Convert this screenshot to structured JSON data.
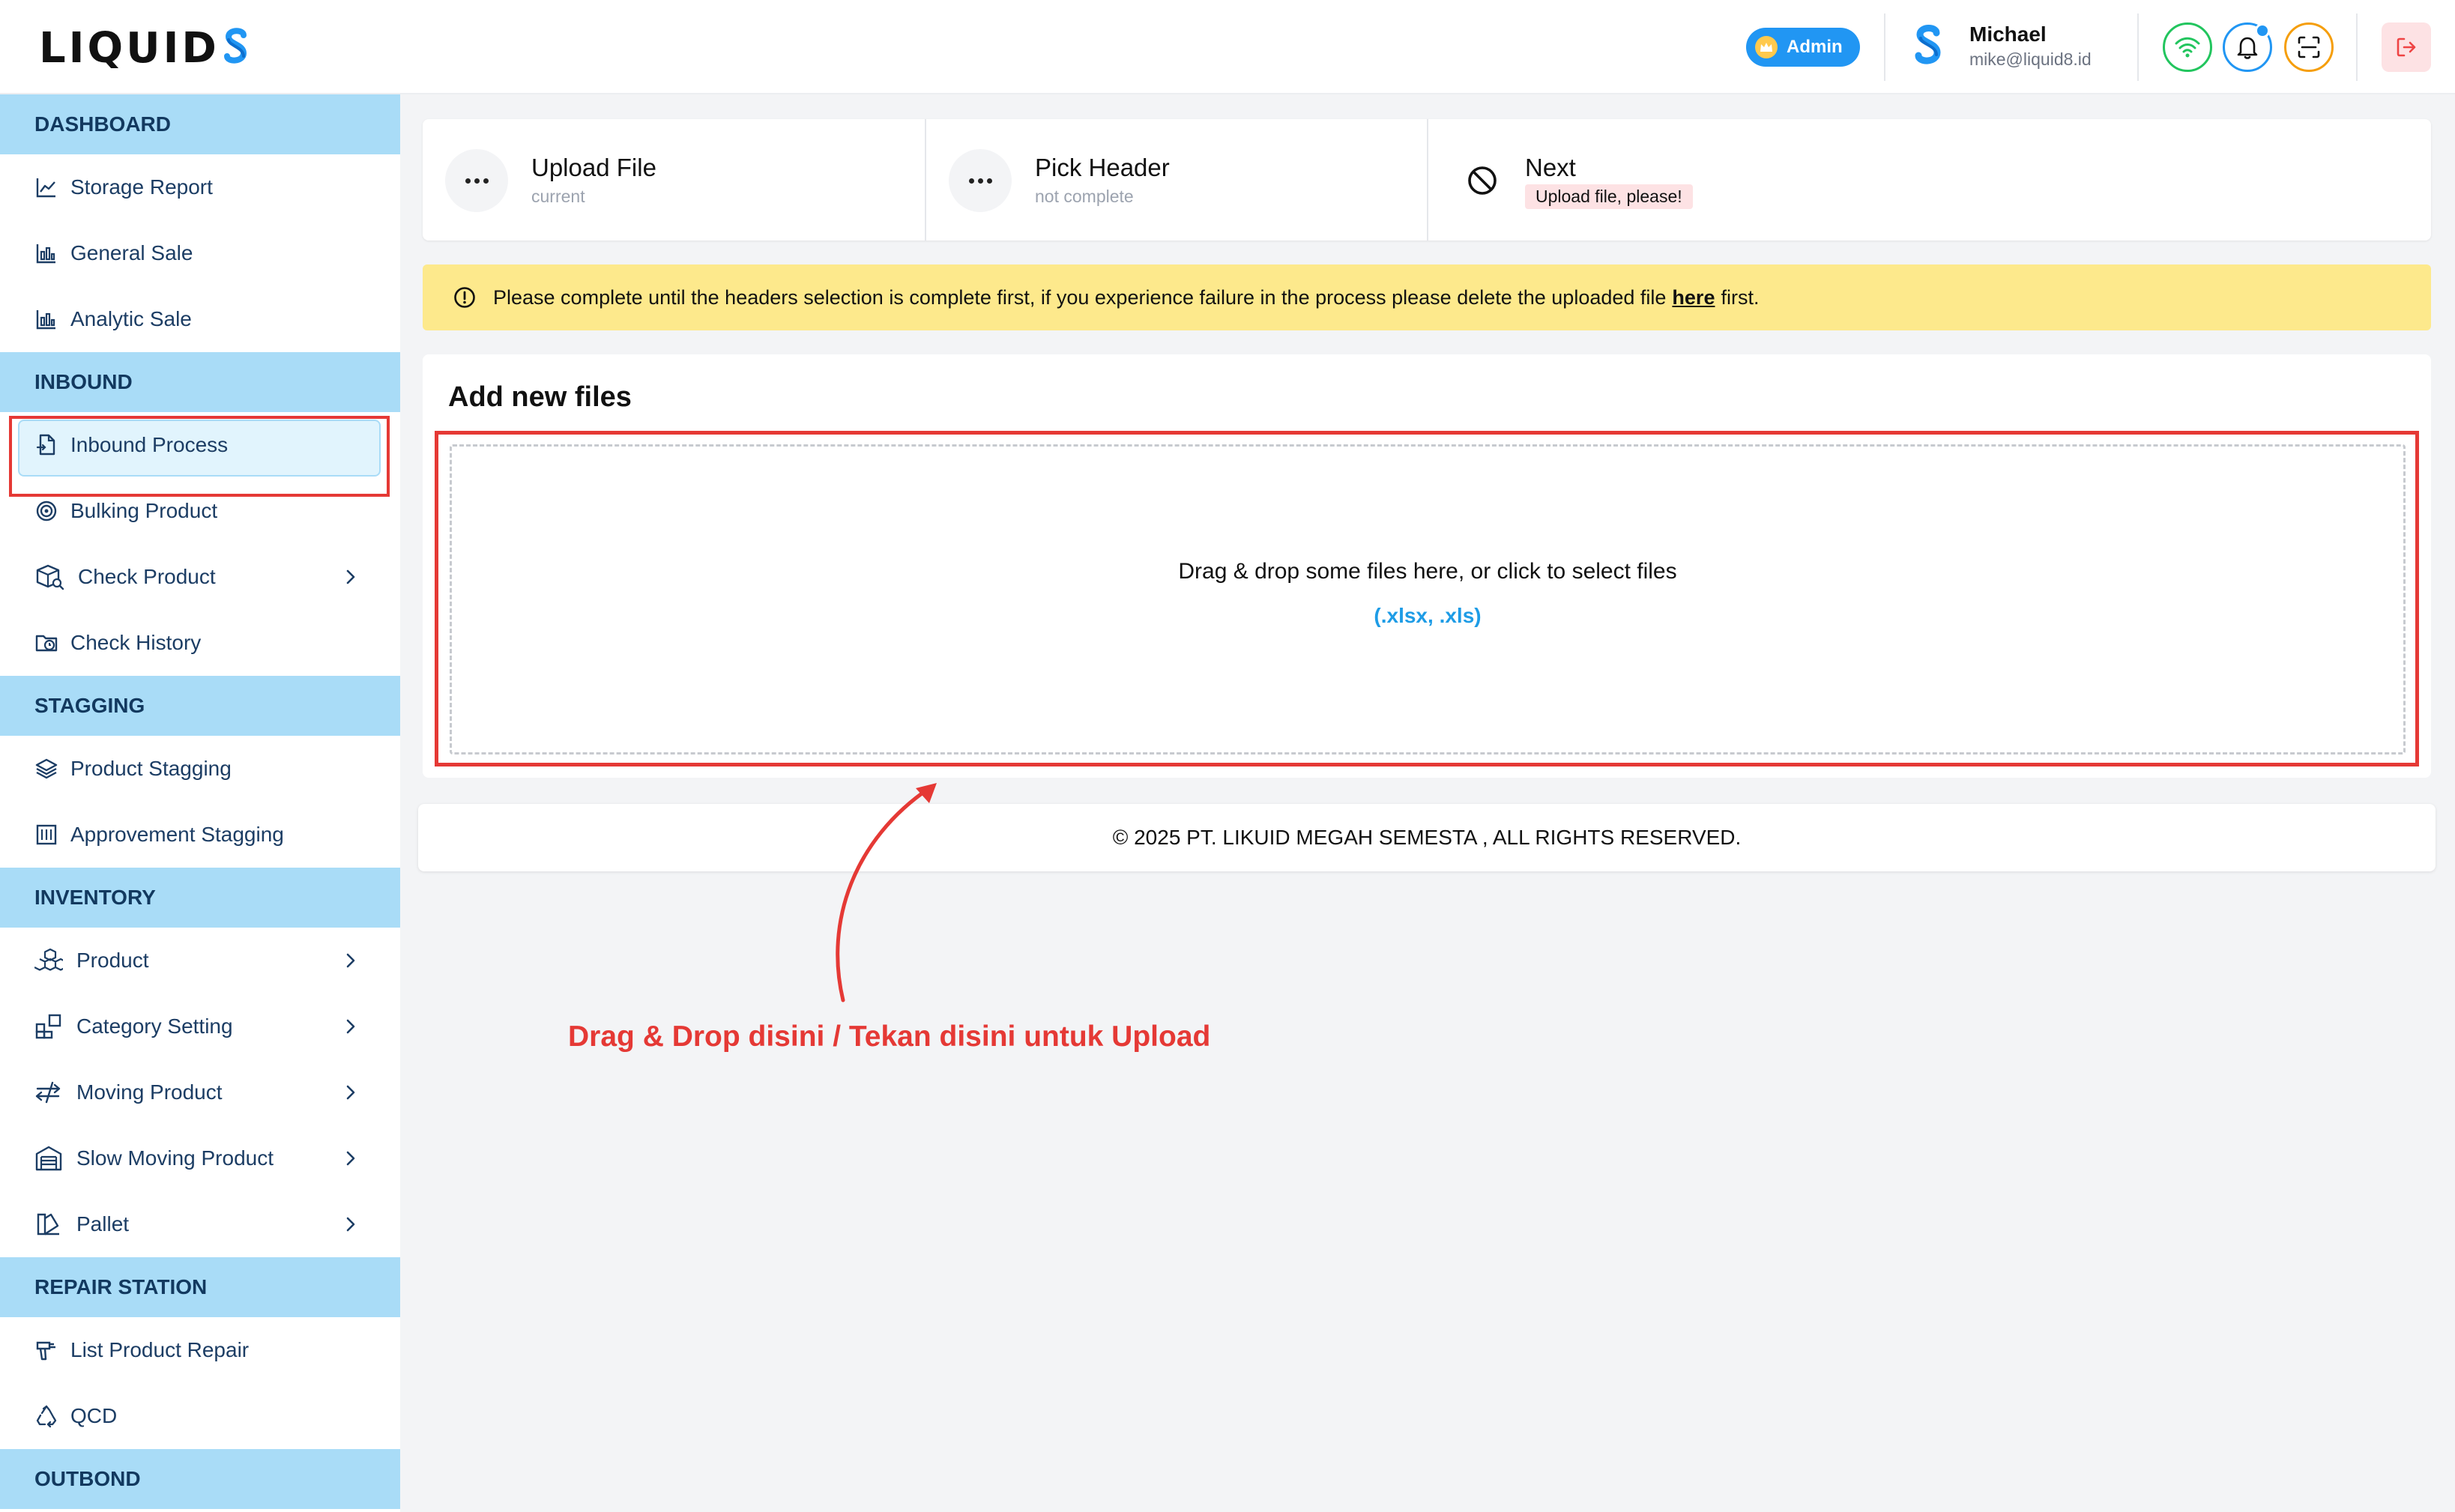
{
  "brand": {
    "logo_text": "LIQUID"
  },
  "header": {
    "role_badge": "Admin",
    "user_name": "Michael",
    "user_email": "mike@liquid8.id"
  },
  "sidebar": {
    "sections": [
      {
        "title": "DASHBOARD",
        "items": [
          {
            "label": "Storage Report",
            "icon": "line-chart-icon"
          },
          {
            "label": "General Sale",
            "icon": "bar-chart-icon"
          },
          {
            "label": "Analytic Sale",
            "icon": "bar-chart-icon"
          }
        ]
      },
      {
        "title": "INBOUND",
        "items": [
          {
            "label": "Inbound Process",
            "icon": "file-import-icon",
            "active": true
          },
          {
            "label": "Bulking Product",
            "icon": "target-icon"
          },
          {
            "label": "Check Product",
            "icon": "box-search-icon",
            "submenu": true
          },
          {
            "label": "Check History",
            "icon": "folder-clock-icon"
          }
        ]
      },
      {
        "title": "STAGGING",
        "items": [
          {
            "label": "Product Stagging",
            "icon": "layers-icon"
          },
          {
            "label": "Approvement Stagging",
            "icon": "columns-icon"
          }
        ]
      },
      {
        "title": "INVENTORY",
        "items": [
          {
            "label": "Product",
            "icon": "boxes-icon",
            "submenu": true
          },
          {
            "label": "Category Setting",
            "icon": "category-icon",
            "submenu": true
          },
          {
            "label": "Moving Product",
            "icon": "arrows-transfer-icon",
            "submenu": true
          },
          {
            "label": "Slow Moving Product",
            "icon": "warehouse-icon",
            "submenu": true
          },
          {
            "label": "Pallet",
            "icon": "pallet-icon",
            "submenu": true
          }
        ]
      },
      {
        "title": "REPAIR STATION",
        "items": [
          {
            "label": "List Product Repair",
            "icon": "drill-icon"
          },
          {
            "label": "QCD",
            "icon": "recycle-icon"
          }
        ]
      },
      {
        "title": "OUTBOND",
        "items": []
      }
    ]
  },
  "stepper": {
    "steps": [
      {
        "title": "Upload File",
        "status": "current"
      },
      {
        "title": "Pick Header",
        "status": "not complete"
      },
      {
        "title": "Next",
        "status": "Upload file, please!"
      }
    ]
  },
  "alert": {
    "text_before": "Please complete until the headers selection is complete first, if you experience failure in the process please delete the uploaded file",
    "link": "here",
    "text_after": "first."
  },
  "upload": {
    "title": "Add new files",
    "prompt": "Drag & drop some files here, or click to select files",
    "extensions": "(.xlsx, .xls)"
  },
  "footer": {
    "text": "© 2025 PT. LIKUID MEGAH SEMESTA , ALL RIGHTS RESERVED."
  },
  "annotation": {
    "text": "Drag & Drop disini / Tekan disini untuk Upload",
    "color": "#e53935"
  },
  "colors": {
    "accent": "#2196f3",
    "section_bg": "#a9dcf7",
    "alert_bg": "#fde98c",
    "annotation_red": "#e53935"
  }
}
